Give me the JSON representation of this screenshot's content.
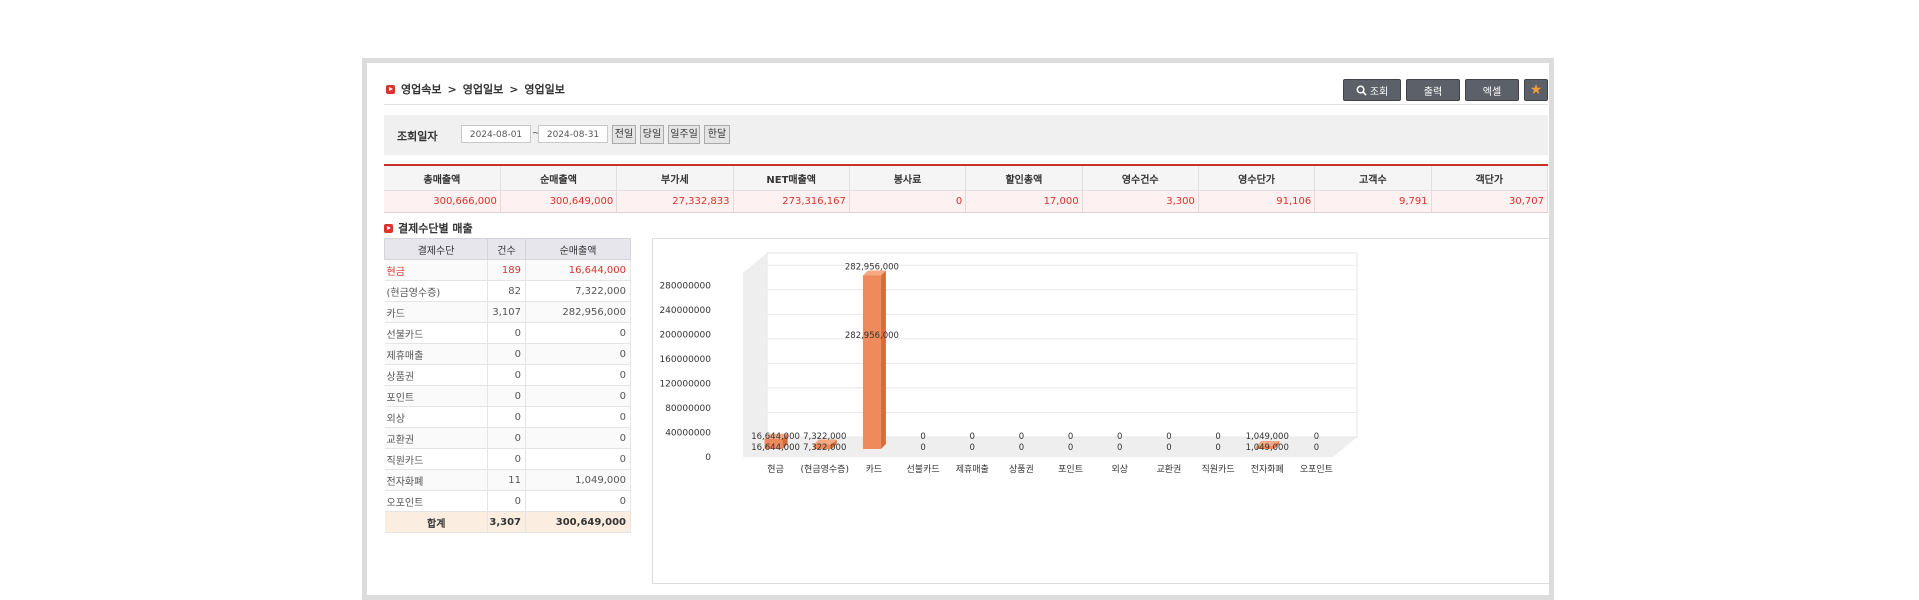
{
  "breadcrumb": [
    "영업속보",
    "영업일보",
    "영업일보"
  ],
  "breadcrumb_sep": ">",
  "toolbar": {
    "search": "조회",
    "print": "출력",
    "excel": "엑셀",
    "star": "★"
  },
  "filter": {
    "label": "조회일자",
    "from": "2024-08-01",
    "to": "2024-08-31",
    "tilde": "~",
    "quick": [
      "전일",
      "당일",
      "일주일",
      "한달"
    ]
  },
  "summary": {
    "headers": [
      "총매출액",
      "순매출액",
      "부가세",
      "NET매출액",
      "봉사료",
      "할인총액",
      "영수건수",
      "영수단가",
      "고객수",
      "객단가"
    ],
    "values": [
      "300,666,000",
      "300,649,000",
      "27,332,833",
      "273,316,167",
      "0",
      "17,000",
      "3,300",
      "91,106",
      "9,791",
      "30,707"
    ]
  },
  "section_title": "결제수단별 매출",
  "payment_table": {
    "headers": [
      "결제수단",
      "건수",
      "순매출액"
    ],
    "rows": [
      {
        "name": "현금",
        "count": "189",
        "amount": "16,644,000"
      },
      {
        "name": "(현금영수증)",
        "count": "82",
        "amount": "7,322,000"
      },
      {
        "name": "카드",
        "count": "3,107",
        "amount": "282,956,000"
      },
      {
        "name": "선불카드",
        "count": "0",
        "amount": "0"
      },
      {
        "name": "제휴매출",
        "count": "0",
        "amount": "0"
      },
      {
        "name": "상품권",
        "count": "0",
        "amount": "0"
      },
      {
        "name": "포인트",
        "count": "0",
        "amount": "0"
      },
      {
        "name": "외상",
        "count": "0",
        "amount": "0"
      },
      {
        "name": "교환권",
        "count": "0",
        "amount": "0"
      },
      {
        "name": "직원카드",
        "count": "0",
        "amount": "0"
      },
      {
        "name": "전자화폐",
        "count": "11",
        "amount": "1,049,000"
      },
      {
        "name": "오포인트",
        "count": "0",
        "amount": "0"
      }
    ],
    "total": {
      "name": "합계",
      "count": "3,307",
      "amount": "300,649,000"
    }
  },
  "colors": {
    "accent": "#d9332c",
    "bar": "#ef8a5c",
    "bar_side": "#d96b3d"
  },
  "chart_data": {
    "type": "bar",
    "categories": [
      "현금",
      "(현금영수증)",
      "카드",
      "선불카드",
      "제휴매출",
      "상품권",
      "포인트",
      "외상",
      "교환권",
      "직원카드",
      "전자화폐",
      "오포인트"
    ],
    "values": [
      16644000,
      7322000,
      282956000,
      0,
      0,
      0,
      0,
      0,
      0,
      0,
      1049000,
      0
    ],
    "data_labels": [
      "16,644,000",
      "7,322,000",
      "282,956,000",
      "0",
      "0",
      "0",
      "0",
      "0",
      "0",
      "0",
      "1,049,000",
      "0"
    ],
    "yticks": [
      "0",
      "40000000",
      "80000000",
      "120000000",
      "160000000",
      "200000000",
      "240000000",
      "280000000"
    ],
    "ylim": [
      0,
      300000000
    ],
    "grid": true
  }
}
